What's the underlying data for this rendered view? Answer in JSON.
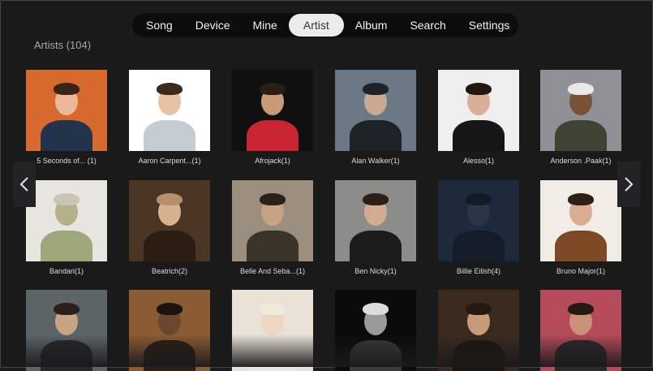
{
  "nav": {
    "tabs": [
      "Song",
      "Device",
      "Mine",
      "Artist",
      "Album",
      "Search",
      "Settings"
    ],
    "active": "Artist"
  },
  "section": {
    "title": "Artists (104)"
  },
  "artists": [
    {
      "label": "5 Seconds of... (1)",
      "bg": "#d8692e",
      "skin": "#e9b999",
      "shirt": "#22324a",
      "hair": "#3a2418"
    },
    {
      "label": "Aaron Carpent...(1)",
      "bg": "#ffffff",
      "skin": "#e7c2a4",
      "shirt": "#c6ccd3",
      "hair": "#3e2a1c"
    },
    {
      "label": "Afrojack(1)",
      "bg": "#101010",
      "skin": "#c89a77",
      "shirt": "#c82432",
      "hair": "#2a1d16"
    },
    {
      "label": "Alan Walker(1)",
      "bg": "#6a7886",
      "skin": "#c9a98f",
      "shirt": "#1d2226",
      "hair": "#1d2226"
    },
    {
      "label": "Alesso(1)",
      "bg": "#efefef",
      "skin": "#d9b097",
      "shirt": "#161616",
      "hair": "#23170f"
    },
    {
      "label": "Anderson .Paak(1)",
      "bg": "#8e9095",
      "skin": "#7a5238",
      "shirt": "#3f4233",
      "hair": "#e9e9e9"
    },
    {
      "label": "Bandari(1)",
      "bg": "#e6e5e0",
      "skin": "#b6b08a",
      "shirt": "#9da779",
      "hair": "#c7c4b4"
    },
    {
      "label": "Beatrich(2)",
      "bg": "#4a3423",
      "skin": "#d8b28e",
      "shirt": "#2a1d14",
      "hair": "#b5906a"
    },
    {
      "label": "Belle And Seba...(1)",
      "bg": "#9a8f7f",
      "skin": "#c9a283",
      "shirt": "#3b3428",
      "hair": "#2a2118"
    },
    {
      "label": "Ben Nicky(1)",
      "bg": "#8c8c88",
      "skin": "#d1ab92",
      "shirt": "#1c1c1c",
      "hair": "#2b2018"
    },
    {
      "label": "Billie Eilish(4)",
      "bg": "#1c2a3c",
      "skin": "#2a3648",
      "shirt": "#131c28",
      "hair": "#121a24"
    },
    {
      "label": "Bruno Major(1)",
      "bg": "#f1ede6",
      "skin": "#d9ad92",
      "shirt": "#7b4a25",
      "hair": "#2d1f16"
    },
    {
      "label": "",
      "bg": "#5d6468",
      "skin": "#c7a386",
      "shirt": "#25292c",
      "hair": "#2a2018"
    },
    {
      "label": "",
      "bg": "#8b5b34",
      "skin": "#6c4630",
      "shirt": "#2b1f16",
      "hair": "#1b140e"
    },
    {
      "label": "",
      "bg": "#e9e2d8",
      "skin": "#efd6c2",
      "shirt": "#e9e4dc",
      "hair": "#f2ead8"
    },
    {
      "label": "",
      "bg": "#0b0b0b",
      "skin": "#9a9a9a",
      "shirt": "#3a3a3a",
      "hair": "#dcdcdc"
    },
    {
      "label": "",
      "bg": "#3a2a1e",
      "skin": "#c79a7a",
      "shirt": "#1e1510",
      "hair": "#24180f"
    },
    {
      "label": "",
      "bg": "#b44a5a",
      "skin": "#c79277",
      "shirt": "#2a2a2a",
      "hair": "#231a14"
    }
  ]
}
